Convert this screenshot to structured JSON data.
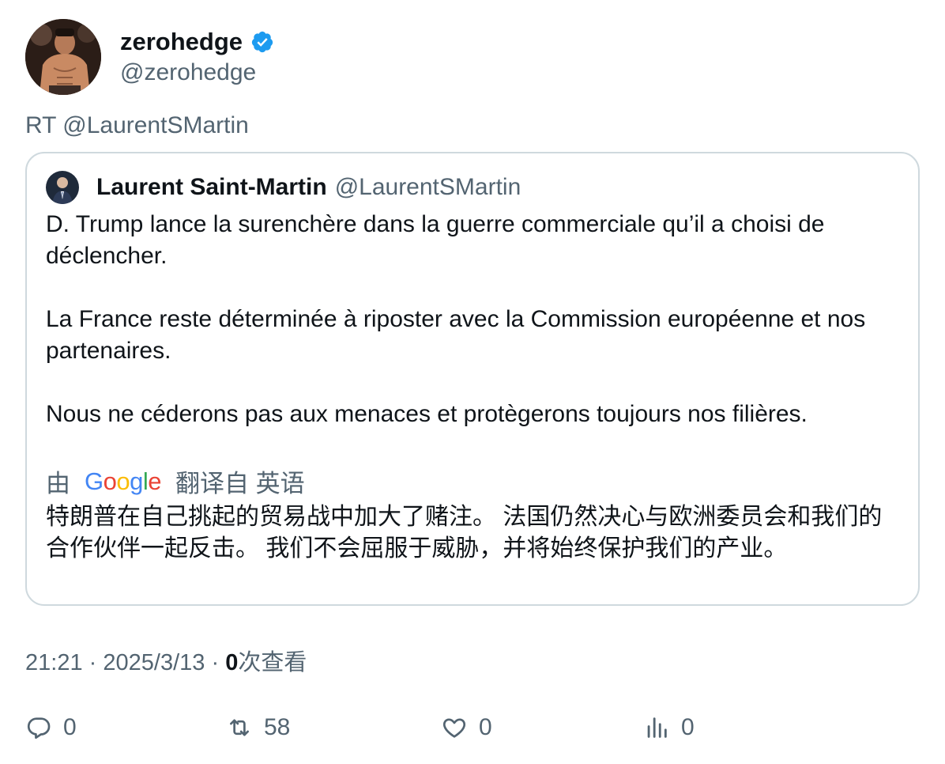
{
  "tweet": {
    "display_name": "zerohedge",
    "handle": "@zerohedge",
    "verified": true,
    "retweet_label": "RT @LaurentSMartin"
  },
  "quote": {
    "display_name": "Laurent Saint-Martin",
    "handle": "@LaurentSMartin",
    "paragraphs": [
      "D. Trump lance la surenchère dans la guerre commerciale qu’il a choisi de déclencher.",
      "La France reste déterminée à riposter avec la Commission européenne et nos partenaires.",
      "Nous ne céderons pas aux menaces et protègerons toujours nos filières."
    ],
    "translate_prefix": "由",
    "translate_brand": "Google",
    "translate_suffix": "翻译自 英语",
    "translated_text": "特朗普在自己挑起的贸易战中加大了赌注。 法国仍然决心与欧洲委员会和我们的合作伙伴一起反击。 我们不会屈服于威胁，并将始终保护我们的产业。"
  },
  "meta": {
    "time": "21:21",
    "sep1": "·",
    "date": "2025/3/13",
    "sep2": "·",
    "views_count": "0",
    "views_label": "次查看"
  },
  "actions": {
    "reply_count": "0",
    "retweet_count": "58",
    "like_count": "0",
    "views_count": "0"
  },
  "colors": {
    "text_primary": "#0f1419",
    "text_secondary": "#536471",
    "border": "#cfd9de",
    "verified_blue": "#1d9bf0"
  },
  "icons": {
    "verified": "verified-badge-icon",
    "reply": "reply-icon",
    "retweet": "retweet-icon",
    "like": "heart-icon",
    "views": "bar-chart-icon"
  }
}
